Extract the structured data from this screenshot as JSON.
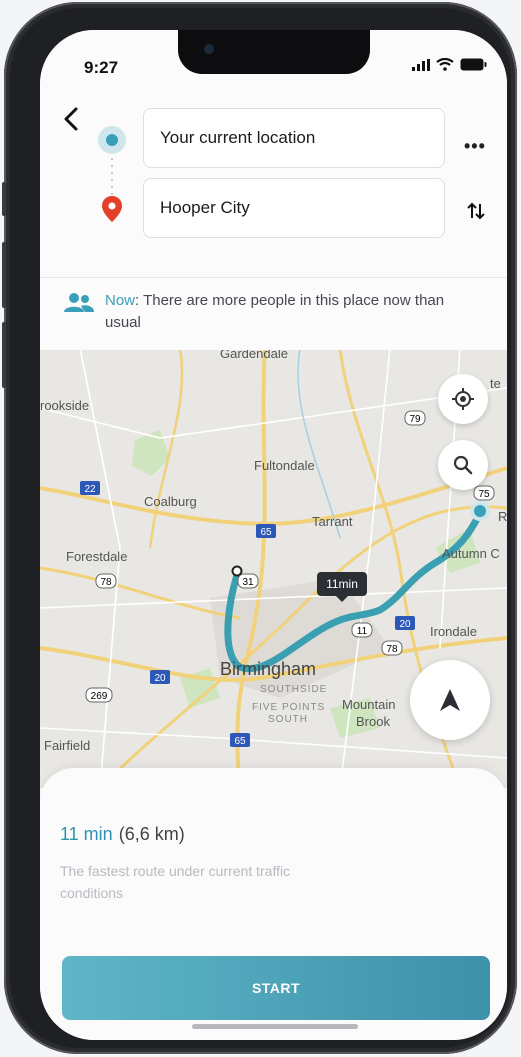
{
  "status_bar": {
    "time": "9:27"
  },
  "route": {
    "origin": "Your current location",
    "destination": "Hooper City"
  },
  "notice": {
    "prefix": "Now",
    "text": ": There are more people in this place now than usual"
  },
  "map": {
    "eta_tag": "11min",
    "labels": {
      "gardendale": "Gardendale",
      "brookside": "rookside",
      "fultondale": "Fultondale",
      "coalburg": "Coalburg",
      "tarrant": "Tarrant",
      "forestdale": "Forestdale",
      "autumn": "Autumn C",
      "irondale": "Irondale",
      "birmingham": "Birmingham",
      "southside": "SOUTHSIDE",
      "fivepoints": "FIVE POINTS",
      "south": "SOUTH",
      "mountain": "Mountain",
      "brook": "Brook",
      "fairfield": "Fairfield",
      "center_r": "te",
      "edge_r": "R"
    },
    "shields": [
      "79",
      "22",
      "65",
      "75",
      "31",
      "78",
      "11",
      "20",
      "78",
      "20",
      "269",
      "65"
    ]
  },
  "summary": {
    "time": "11 min",
    "distance": "(6,6 km)",
    "description": "The fastest route under current traffic conditions",
    "start_label": "START"
  },
  "colors": {
    "accent": "#3aa0b9",
    "pin_red": "#e2402b",
    "route": "#3a9fb0"
  }
}
